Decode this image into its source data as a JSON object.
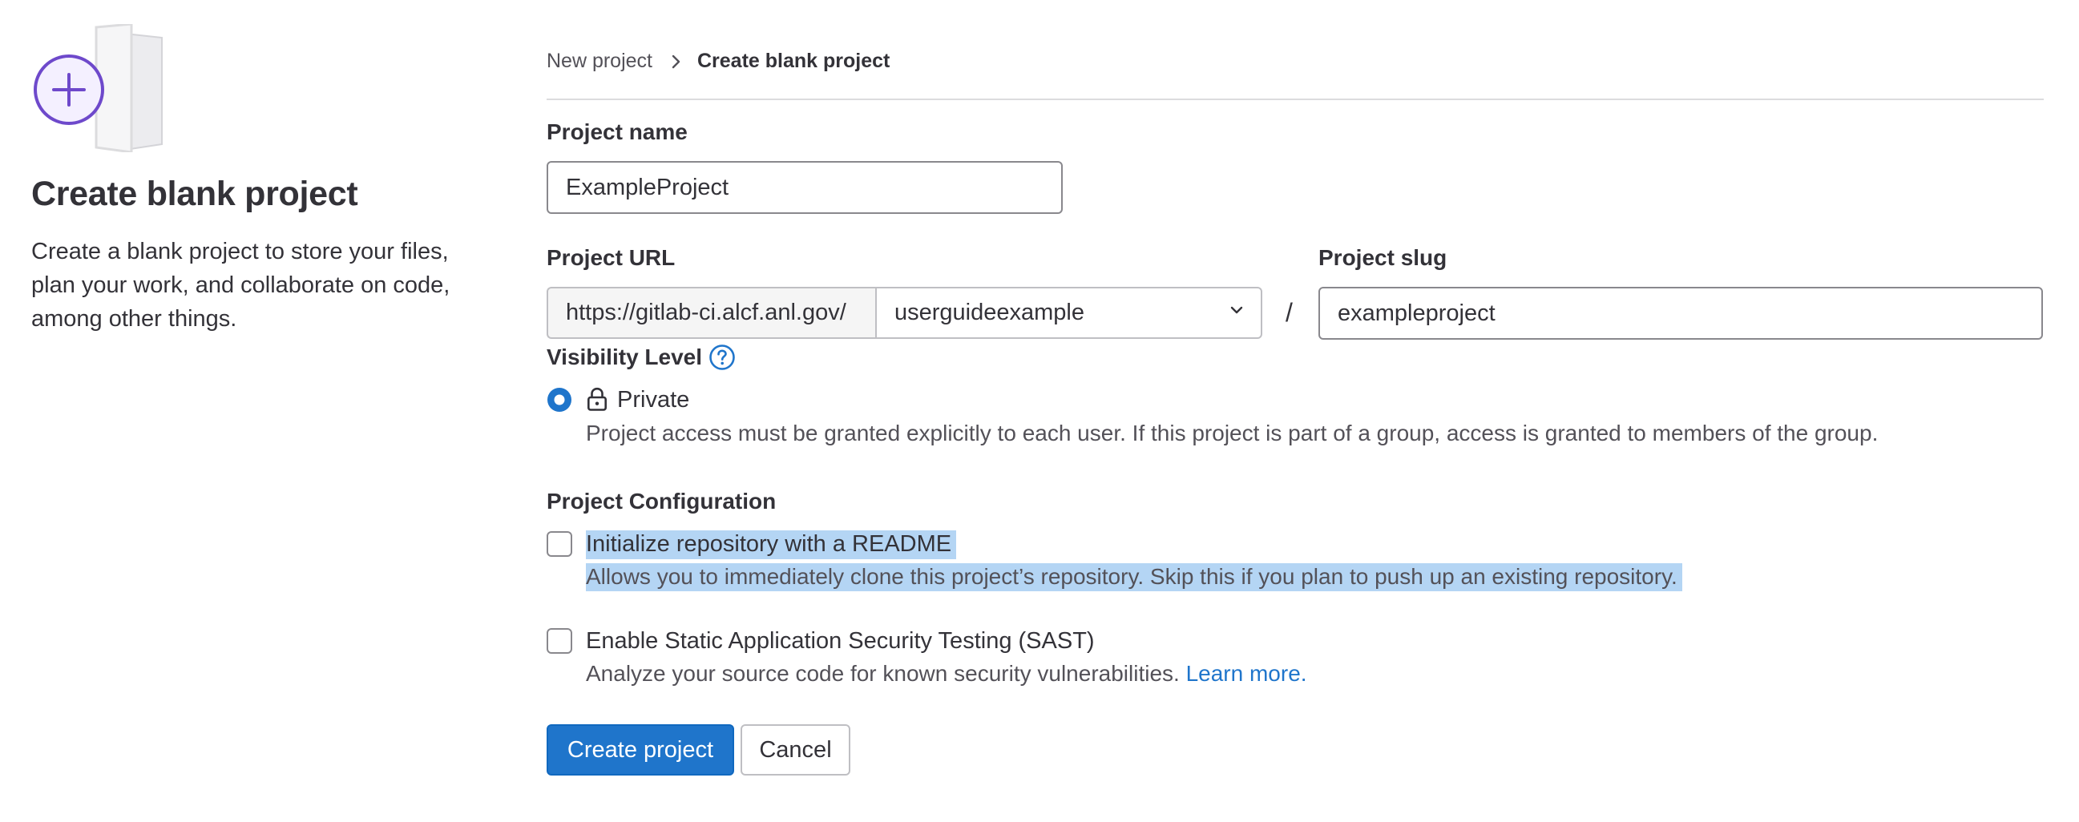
{
  "left": {
    "title": "Create blank project",
    "description": "Create a blank project to store your files, plan your work, and collaborate on code, among other things."
  },
  "breadcrumb": {
    "parent": "New project",
    "current": "Create blank project"
  },
  "form": {
    "project_name_label": "Project name",
    "project_name_value": "ExampleProject",
    "project_url_label": "Project URL",
    "url_prefix": "https://gitlab-ci.alcf.anl.gov/",
    "namespace_value": "userguideexample",
    "slash": "/",
    "project_slug_label": "Project slug",
    "project_slug_value": "exampleproject",
    "visibility_label": "Visibility Level",
    "visibility_option": "Private",
    "visibility_help": "Project access must be granted explicitly to each user. If this project is part of a group, access is granted to members of the group.",
    "config_label": "Project Configuration",
    "readme_label": "Initialize repository with a README",
    "readme_help": "Allows you to immediately clone this project’s repository. Skip this if you plan to push up an existing repository.",
    "sast_label": "Enable Static Application Security Testing (SAST)",
    "sast_help": "Analyze your source code for known security vulnerabilities.",
    "learn_more": "Learn more."
  },
  "actions": {
    "create": "Create project",
    "cancel": "Cancel"
  },
  "colors": {
    "primary": "#1f75cb",
    "illustration_accent": "#6e49cb",
    "selection_highlight": "#b4d5f4"
  },
  "icons": [
    "new-project-illustration",
    "chevron-right-icon",
    "chevron-down-icon",
    "question-circle-icon",
    "lock-icon"
  ]
}
